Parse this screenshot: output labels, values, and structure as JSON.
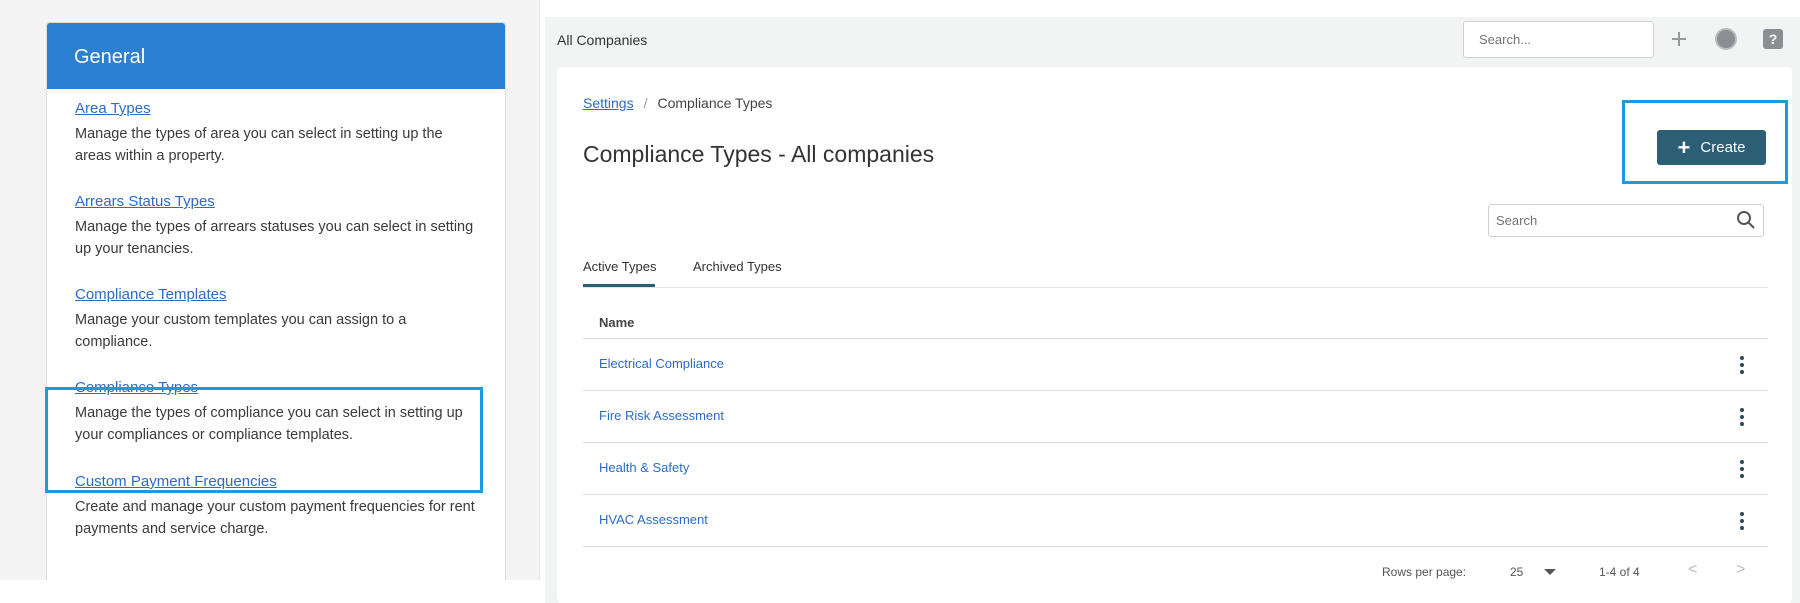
{
  "sidebar": {
    "header": "General",
    "items": [
      {
        "title": "Area Types",
        "description": "Manage the types of area you can select in setting up the areas within a property."
      },
      {
        "title": "Arrears Status Types",
        "description": "Manage the types of arrears statuses you can select in setting up your tenancies."
      },
      {
        "title": "Compliance Templates",
        "description": "Manage your custom templates you can assign to a compliance."
      },
      {
        "title": "Compliance Types",
        "description": "Manage the types of compliance you can select in setting up your compliances or compliance templates."
      },
      {
        "title": "Custom Payment Frequencies",
        "description": "Create and manage your custom payment frequencies for rent payments and service charge."
      }
    ]
  },
  "topbar": {
    "title": "All Companies",
    "search_placeholder": "Search...",
    "icons": [
      "plus-icon",
      "user-icon",
      "help-icon"
    ]
  },
  "breadcrumb": {
    "root": "Settings",
    "separator": "/",
    "current": "Compliance Types"
  },
  "page": {
    "title": "Compliance Types - All companies",
    "create_label": "Create"
  },
  "search": {
    "placeholder": "Search"
  },
  "tabs": {
    "active": "Active Types",
    "archived": "Archived Types"
  },
  "table": {
    "column": "Name",
    "rows": [
      "Electrical Compliance",
      "Fire Risk Assessment",
      "Health & Safety",
      "HVAC Assessment"
    ]
  },
  "pagination": {
    "rows_label": "Rows per page:",
    "rows_value": "25",
    "range": "1-4 of 4",
    "prev": "<",
    "next": ">"
  },
  "colors": {
    "header_blue": "#2c80d4",
    "primary": "#2c5f75",
    "link": "#2c6bc8",
    "highlight": "#1d9be0"
  }
}
